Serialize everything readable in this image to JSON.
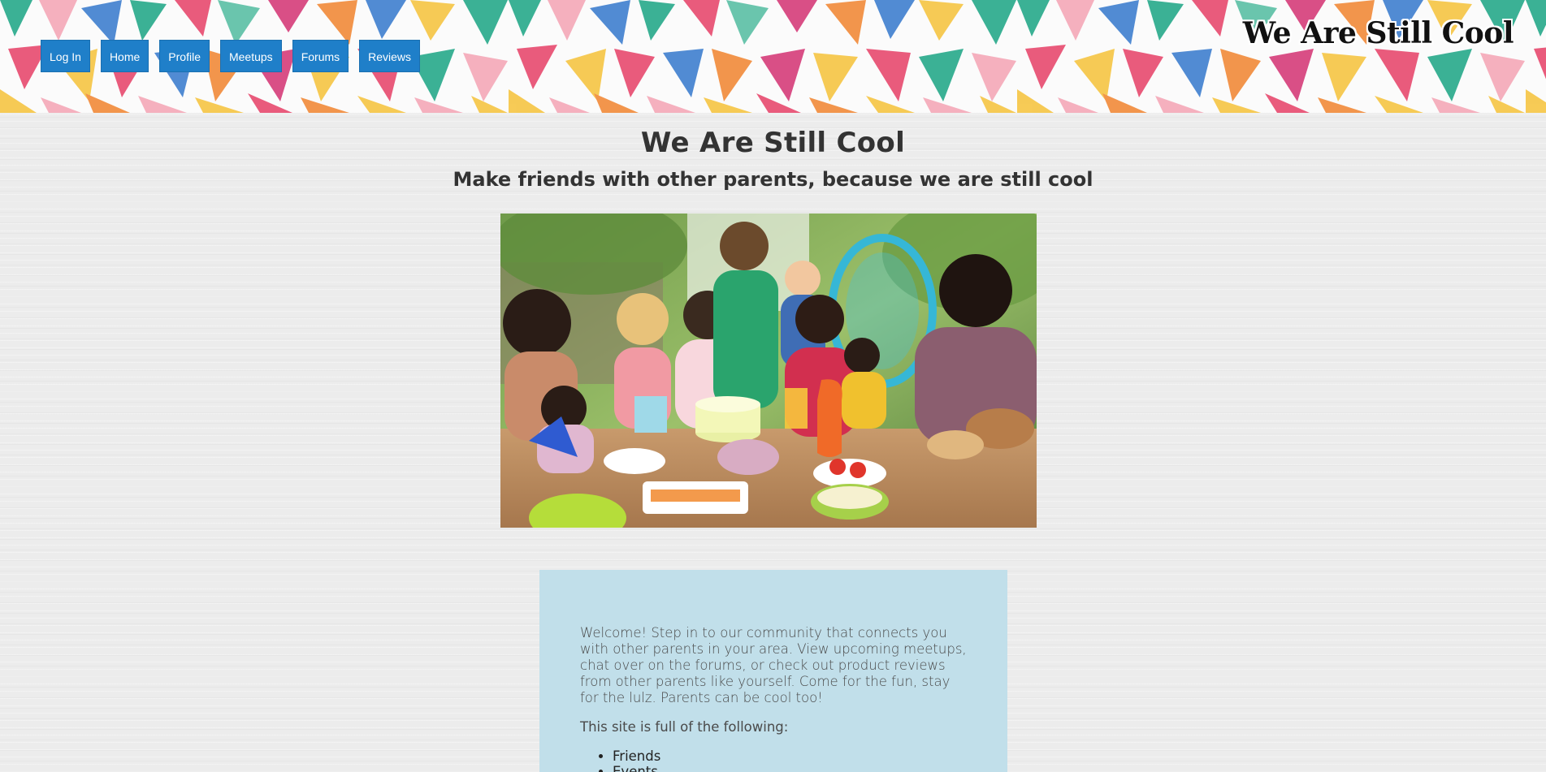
{
  "header": {
    "brand": "We Are Still Cool",
    "nav": [
      {
        "label": "Log In"
      },
      {
        "label": "Home"
      },
      {
        "label": "Profile"
      },
      {
        "label": "Meetups"
      },
      {
        "label": "Forums"
      },
      {
        "label": "Reviews"
      }
    ],
    "banner_colors": [
      "#e84a6f",
      "#f6c544",
      "#27a98a",
      "#3f7fcf",
      "#f28b3a",
      "#d63d7a",
      "#5bc0a5",
      "#f5a8b8"
    ]
  },
  "main": {
    "title": "We Are Still Cool",
    "subtitle": "Make friends with other parents, because we are still cool",
    "hero_image": "family-celebration-photo",
    "welcome": {
      "text": "Welcome! Step in to our community that connects you with other parents in your area. View upcoming meetups, chat over on the forums, or check out product reviews from other parents like yourself. Come for the fun, stay for the lulz. Parents can be cool too!",
      "list_intro": "This site is full of the following:",
      "features": [
        "Friends",
        "Events"
      ]
    }
  },
  "colors": {
    "nav_button": "#1f7fc9",
    "welcome_box": "#c1dfea",
    "page_background": "#ececec"
  }
}
